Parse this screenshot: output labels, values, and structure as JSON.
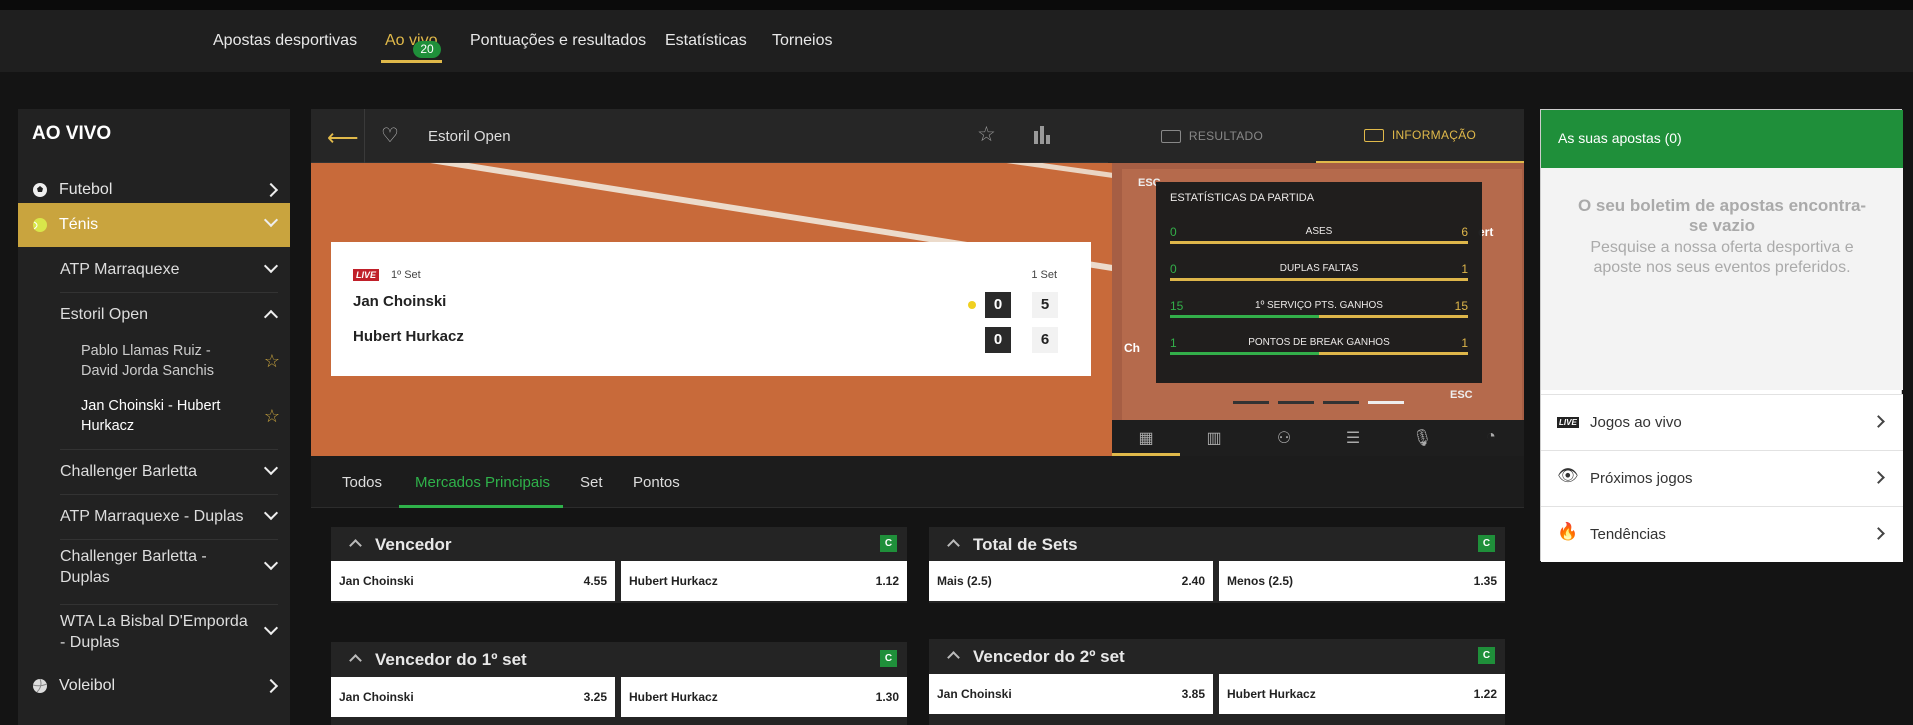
{
  "nav": {
    "items": [
      "Apostas desportivas",
      "Ao vivo",
      "Pontuações e resultados",
      "Estatísticas",
      "Torneios"
    ],
    "live_count": "20"
  },
  "sidebar": {
    "title": "AO VIVO",
    "sports": {
      "futebol": "Futebol",
      "tenis": "Ténis",
      "voleibol": "Voleibol"
    },
    "tournaments": [
      "ATP Marraquexe",
      "Estoril Open",
      "Challenger Barletta",
      "ATP Marraquexe - Duplas",
      "Challenger Barletta - Duplas",
      "WTA La Bisbal D'Emporda - Duplas"
    ],
    "matches": [
      "Pablo Llamas Ruiz - David Jorda Sanchis",
      "Jan Choinski - Hubert Hurkacz"
    ]
  },
  "event": {
    "name": "Estoril Open",
    "tabs": {
      "result": "RESULTADO",
      "info": "INFORMAÇÃO"
    }
  },
  "scoreboard": {
    "live": "LIVE",
    "set_label": "1º Set",
    "set_col": "1 Set",
    "players": [
      {
        "name": "Jan Choinski",
        "games": "0",
        "set": "5"
      },
      {
        "name": "Hubert Hurkacz",
        "games": "0",
        "set": "6"
      }
    ]
  },
  "stats": {
    "title": "ESTATÍSTICAS DA PARTIDA",
    "rows": [
      {
        "label": "ASES",
        "left": "0",
        "right": "6",
        "left_frac": 0.0
      },
      {
        "label": "DUPLAS FALTAS",
        "left": "0",
        "right": "1",
        "left_frac": 0.0
      },
      {
        "label": "1º SERVIÇO PTS. GANHOS",
        "left": "15",
        "right": "15",
        "left_frac": 0.5
      },
      {
        "label": "PONTOS DE BREAK GANHOS",
        "left": "1",
        "right": "1",
        "left_frac": 0.5
      }
    ],
    "overlay_labels": {
      "esc": "ESC",
      "left_name": "Ch",
      "right_name": "ert"
    }
  },
  "markets_tabs": [
    "Todos",
    "Mercados Principais",
    "Set",
    "Pontos"
  ],
  "markets": [
    {
      "title": "Vencedor",
      "odds": [
        {
          "name": "Jan Choinski",
          "value": "4.55"
        },
        {
          "name": "Hubert Hurkacz",
          "value": "1.12"
        }
      ]
    },
    {
      "title": "Total de Sets",
      "odds": [
        {
          "name": "Mais (2.5)",
          "value": "2.40"
        },
        {
          "name": "Menos (2.5)",
          "value": "1.35"
        }
      ]
    },
    {
      "title": "Vencedor do 1º set",
      "odds": [
        {
          "name": "Jan Choinski",
          "value": "3.25"
        },
        {
          "name": "Hubert Hurkacz",
          "value": "1.30"
        }
      ]
    },
    {
      "title": "Vencedor do 2º set",
      "odds": [
        {
          "name": "Jan Choinski",
          "value": "3.85"
        },
        {
          "name": "Hubert Hurkacz",
          "value": "1.22"
        }
      ]
    }
  ],
  "cashout_label": "C",
  "betslip": {
    "header": "As suas apostas (0)",
    "empty_title": "O seu boletim de apostas encontra-se vazio",
    "empty_text": "Pesquise a nossa oferta desportiva e aposte nos seus eventos preferidos.",
    "links": [
      "Jogos ao vivo",
      "Próximos jogos",
      "Tendências"
    ],
    "live_tag": "LIVE"
  },
  "colors": {
    "accent": "#e0b94a",
    "green": "#1f8f3a",
    "court": "#c86a3a"
  }
}
